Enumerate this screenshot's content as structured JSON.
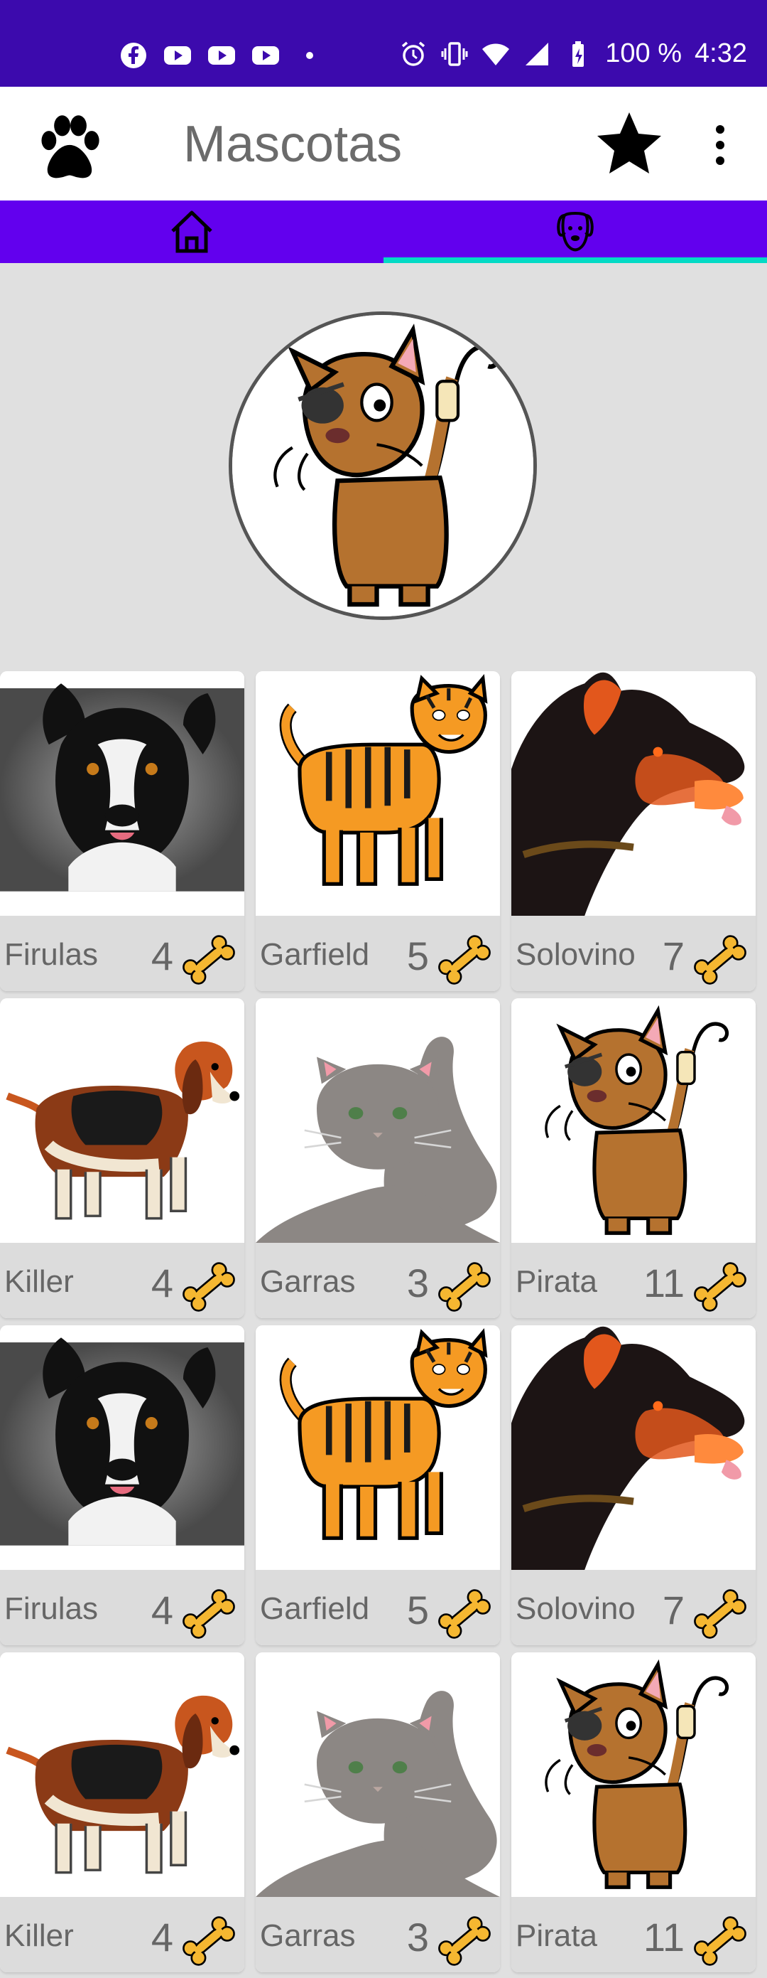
{
  "status_bar": {
    "battery": "100 %",
    "time": "4:32",
    "icons": [
      "facebook-icon",
      "youtube-icon",
      "youtube-icon",
      "youtube-icon",
      "dot-icon",
      "alarm-icon",
      "vibrate-icon",
      "wifi-icon",
      "signal-icon",
      "battery-icon"
    ]
  },
  "app_bar": {
    "title": "Mascotas",
    "logo_icon": "paw-icon",
    "actions": [
      "star-icon",
      "more-vert-icon"
    ]
  },
  "tabs": [
    {
      "icon": "home-icon",
      "selected": false
    },
    {
      "icon": "dog-face-icon",
      "selected": true
    }
  ],
  "colors": {
    "status_bar": "#3c0aad",
    "tab_bar": "#6200ee",
    "tab_indicator": "#03dac5",
    "background": "#e0e0e0",
    "bone": "#f5b731"
  },
  "profile": {
    "image": "pirate-cat"
  },
  "pets": [
    {
      "name": "Firulas",
      "rating": "4",
      "image": "border-collie"
    },
    {
      "name": "Garfield",
      "rating": "5",
      "image": "tiger-cat"
    },
    {
      "name": "Solovino",
      "rating": "7",
      "image": "doberman"
    },
    {
      "name": "Killer",
      "rating": "4",
      "image": "beagle"
    },
    {
      "name": "Garras",
      "rating": "3",
      "image": "grey-kitten"
    },
    {
      "name": "Pirata",
      "rating": "11",
      "image": "pirate-cat"
    },
    {
      "name": "Firulas",
      "rating": "4",
      "image": "border-collie"
    },
    {
      "name": "Garfield",
      "rating": "5",
      "image": "tiger-cat"
    },
    {
      "name": "Solovino",
      "rating": "7",
      "image": "doberman"
    },
    {
      "name": "Killer",
      "rating": "4",
      "image": "beagle"
    },
    {
      "name": "Garras",
      "rating": "3",
      "image": "grey-kitten"
    },
    {
      "name": "Pirata",
      "rating": "11",
      "image": "pirate-cat"
    }
  ]
}
